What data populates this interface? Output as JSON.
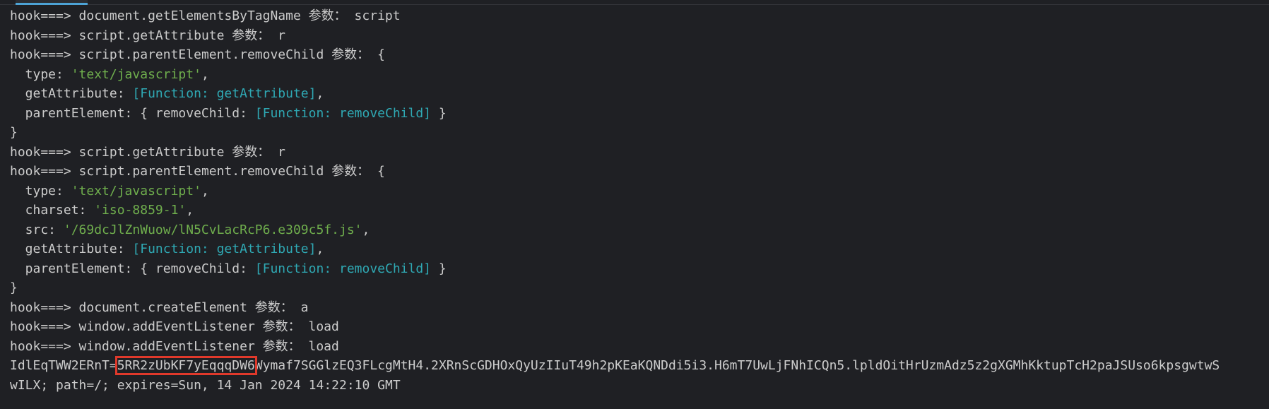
{
  "terminal": {
    "lines": [
      {
        "prefix": "hook===> ",
        "call": "document.getElementsByTagName",
        "label": " 参数： ",
        "arg": "script"
      },
      {
        "prefix": "hook===> ",
        "call": "script.getAttribute",
        "label": " 参数： ",
        "arg": "r"
      },
      {
        "prefix": "hook===> ",
        "call": "script.parentElement.removeChild",
        "label": " 参数： ",
        "arg": "{"
      },
      {
        "key": "  type: ",
        "value": "'text/javascript'",
        "tail": ","
      },
      {
        "key": "  getAttribute: ",
        "value": "[Function: getAttribute]",
        "tail": ","
      },
      {
        "key": "  parentElement: { removeChild: ",
        "value": "[Function: removeChild]",
        "tail": " }"
      },
      {
        "text": "}"
      },
      {
        "prefix": "hook===> ",
        "call": "script.getAttribute",
        "label": " 参数： ",
        "arg": "r"
      },
      {
        "prefix": "hook===> ",
        "call": "script.parentElement.removeChild",
        "label": " 参数： ",
        "arg": "{"
      },
      {
        "key": "  type: ",
        "value": "'text/javascript'",
        "tail": ","
      },
      {
        "key": "  charset: ",
        "value": "'iso-8859-1'",
        "tail": ","
      },
      {
        "key": "  src: ",
        "value": "'/69dcJlZnWuow/lN5CvLacRcP6.e309c5f.js'",
        "tail": ","
      },
      {
        "key": "  getAttribute: ",
        "value": "[Function: getAttribute]",
        "tail": ","
      },
      {
        "key": "  parentElement: { removeChild: ",
        "value": "[Function: removeChild]",
        "tail": " }"
      },
      {
        "text": "}"
      },
      {
        "prefix": "hook===> ",
        "call": "document.createElement",
        "label": " 参数： ",
        "arg": "a"
      },
      {
        "prefix": "hook===> ",
        "call": "window.addEventListener",
        "label": " 参数： ",
        "arg": "load"
      },
      {
        "prefix": "hook===> ",
        "call": "window.addEventListener",
        "label": " 参数： ",
        "arg": "load"
      }
    ],
    "cookie": {
      "name": "IdlEqTWW2ERnT=",
      "highlight": "5RR2zUbKF7yEqqqDW6",
      "rest": "Wymaf7SGGlzEQ3FLcgMtH4.2XRnScGDHOxQyUzIIuT49h2pKEaKQNDdi5i3.H6mT7UwLjFNhICQn5.lpldOitHrUzmAdz5z2gXGMhKktupTcH2paJSUso6kpsgwtwS",
      "line2": "wILX; path=/; expires=Sun, 14 Jan 2024 14:22:10 GMT"
    }
  },
  "colors": {
    "background": "#1f2024",
    "text": "#cccccc",
    "string": "#6fae4d",
    "function": "#2fa9b4",
    "highlight_box": "#e0392b",
    "tab_accent": "#4da3d6"
  }
}
